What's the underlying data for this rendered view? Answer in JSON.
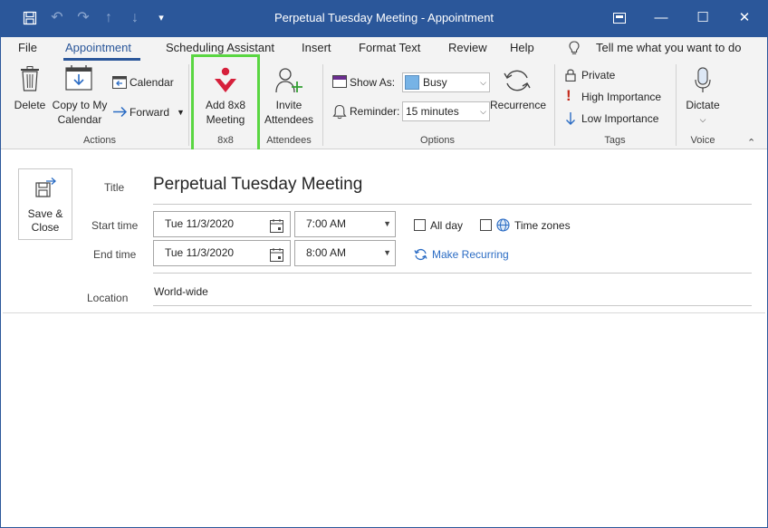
{
  "window": {
    "title": "Perpetual Tuesday Meeting  -  Appointment",
    "minimize": "—",
    "restore": "☐",
    "close": "✕",
    "ribbon_display": "⊡"
  },
  "qat": {
    "save": "🖫",
    "undo": "↶",
    "redo": "↷",
    "up": "↑",
    "down": "↓",
    "customize": "▾"
  },
  "menu": {
    "tabs": [
      "File",
      "Appointment",
      "Scheduling Assistant",
      "Insert",
      "Format Text",
      "Review",
      "Help"
    ],
    "tell_me": "Tell me what you want to do"
  },
  "ribbon": {
    "actions": {
      "delete": "Delete",
      "copy_line1": "Copy to My",
      "copy_line2": "Calendar",
      "calendar": "Calendar",
      "forward": "Forward",
      "group": "Actions"
    },
    "eightx8": {
      "line1": "Add 8x8",
      "line2": "Meeting",
      "group": "8x8",
      "highlight": "#5ad642",
      "brand": "#d6203b"
    },
    "attendees": {
      "line1": "Invite",
      "line2": "Attendees",
      "group": "Attendees"
    },
    "options": {
      "show_as_label": "Show As:",
      "show_as_value": "Busy",
      "reminder_label": "Reminder:",
      "reminder_value": "15 minutes",
      "recurrence": "Recurrence",
      "group": "Options",
      "busy_color": "#77b3e6"
    },
    "tags": {
      "private": "Private",
      "high": "High Importance",
      "low": "Low Importance",
      "group": "Tags"
    },
    "voice": {
      "dictate": "Dictate",
      "group": "Voice"
    }
  },
  "form": {
    "save_line1": "Save &",
    "save_line2": "Close",
    "title_label": "Title",
    "title_value": "Perpetual Tuesday Meeting",
    "start_label": "Start time",
    "start_date": "Tue 11/3/2020",
    "start_time": "7:00 AM",
    "end_label": "End time",
    "end_date": "Tue 11/3/2020",
    "end_time": "8:00 AM",
    "all_day": "All day",
    "time_zones": "Time zones",
    "make_recurring": "Make Recurring",
    "location_label": "Location",
    "location_value": "World-wide"
  },
  "colors": {
    "accent": "#2b579a",
    "link": "#2b6cc4",
    "high_importance": "#c42b1c",
    "low_importance": "#2b6cc4"
  }
}
